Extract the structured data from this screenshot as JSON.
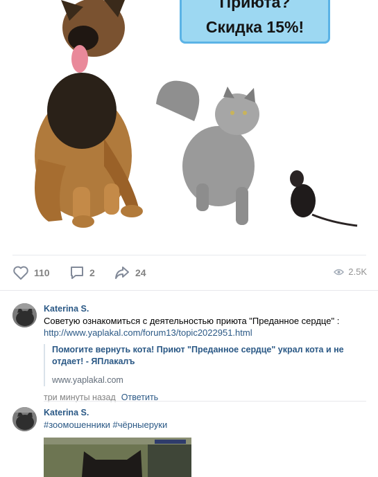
{
  "promo": {
    "line1": "Приюта?",
    "line2": "Скидка 15%!"
  },
  "actions": {
    "likes": "110",
    "comments": "2",
    "shares": "24",
    "views": "2.5K"
  },
  "comments": [
    {
      "author": "Katerina S.",
      "text": "Советую ознакомиться с деятельностью приюта \"Преданное сердце\" :",
      "link": "http://www.yaplakal.com/forum13/topic2022951.html",
      "snippet_title": "Помогите вернуть кота! Приют \"Преданное сердце\" украл кота и не отдает! - ЯПлакалъ",
      "snippet_domain": "www.yaplakal.com",
      "time": "три минуты назад",
      "reply": "Ответить"
    },
    {
      "author": "Katerina S.",
      "text": "#зоомошенники #чёрныеруки"
    }
  ],
  "colors": {
    "accent": "#2a5885",
    "promo_bg": "#9dd8f2",
    "promo_border": "#5bb3e6",
    "muted": "#828282"
  }
}
